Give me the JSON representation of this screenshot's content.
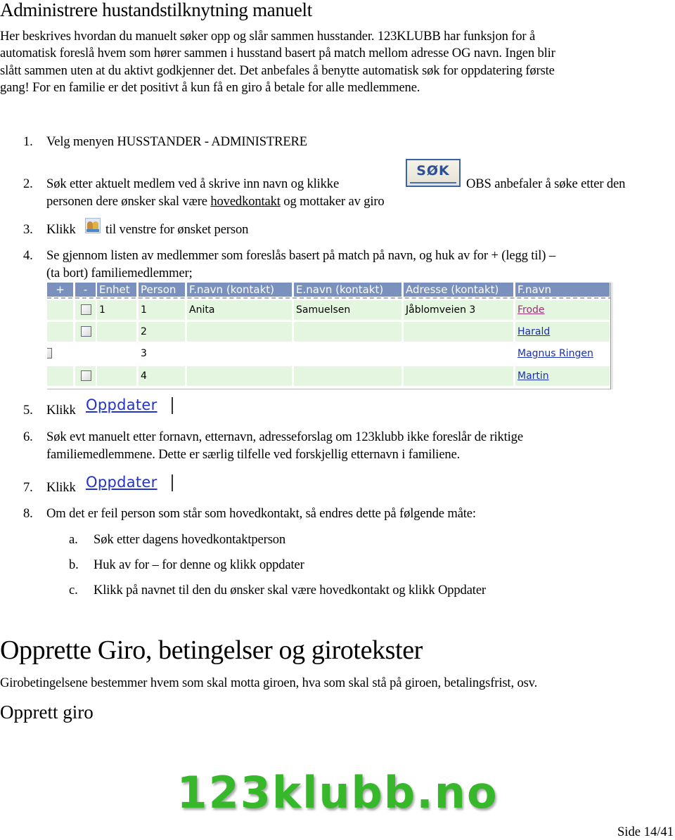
{
  "section1": {
    "title": "Administrere hustandstilknytning manuelt",
    "intro_lines": [
      "Her beskrives hvordan du manuelt søker opp og slår sammen husstander. 123KLUBB har funksjon for å",
      "automatisk foreslå hvem som hører sammen i husstand basert på match mellom adresse OG navn. Ingen blir",
      "slått sammen uten at du aktivt godkjenner det. Det anbefales å benytte automatisk søk for oppdatering første",
      "gang! For en familie er det positivt å kun få en giro å betale for alle medlemmene."
    ]
  },
  "steps": {
    "s1": {
      "num": "1.",
      "text": "Velg menyen HUSSTANDER - ADMINISTRERE"
    },
    "s2": {
      "num": "2.",
      "text_before": "Søk etter aktuelt medlem ved å skrive inn navn og klikke",
      "button_label": "SØK",
      "text_after": "OBS anbefaler å søke etter den",
      "line2_before": "personen dere ønsker skal være ",
      "line2_underlined": "hovedkontakt",
      "line2_after": " og mottaker av giro"
    },
    "s3": {
      "num": "3.",
      "text_before": "Klikk",
      "icon": "household-icon",
      "text_after": "til venstre for ønsket person"
    },
    "s4": {
      "num": "4.",
      "line1": "Se gjennom listen av medlemmer som foreslås basert på match på navn, og huk av for + (legg til) –",
      "line2": "(ta bort) familiemedlemmer;"
    },
    "s5": {
      "num": "5.",
      "text": "Klikk",
      "button_label": "Oppdater"
    },
    "s6": {
      "num": "6.",
      "line1": "Søk evt manuelt etter fornavn, etternavn, adresseforslag om 123klubb ikke foreslår de riktige",
      "line2": "familiemedlemmene. Dette er særlig tilfelle ved forskjellig etternavn i familiene."
    },
    "s7": {
      "num": "7.",
      "text": "Klikk",
      "button_label": "Oppdater"
    },
    "s8": {
      "num": "8.",
      "text": "Om det er feil person som står som hovedkontakt, så endres dette på følgende måte:",
      "sub": [
        {
          "num": "a.",
          "text": "Søk etter dagens hovedkontaktperson"
        },
        {
          "num": "b.",
          "text": "Huk av for – for denne og klikk oppdater"
        },
        {
          "num": "c.",
          "text": "Klikk på navnet til den du ønsker skal være hovedkontakt og klikk Oppdater"
        }
      ]
    }
  },
  "member_table": {
    "headers": [
      "+",
      "-",
      "Enhet",
      "Person",
      "F.navn (kontakt)",
      "E.navn (kontakt)",
      "Adresse (kontakt)",
      "F.navn"
    ],
    "header_color": "#7a90bd",
    "row_color": "#e4f6df",
    "rows": [
      {
        "plus_checkbox": false,
        "minus_checkbox": true,
        "enhet": "1",
        "person": "1",
        "fnavn_kontakt": "Anita",
        "enavn_kontakt": "Samuelsen",
        "adresse_kontakt": "Jåblomveien 3",
        "fnavn": "Frode",
        "checked": false,
        "highlight": true
      },
      {
        "plus_checkbox": false,
        "minus_checkbox": true,
        "enhet": "",
        "person": "2",
        "fnavn_kontakt": "",
        "enavn_kontakt": "",
        "adresse_kontakt": "",
        "fnavn": "Harald",
        "checked": false,
        "highlight": true
      },
      {
        "plus_checkbox": true,
        "minus_checkbox": false,
        "enhet": "",
        "person": "3",
        "fnavn_kontakt": "",
        "enavn_kontakt": "",
        "adresse_kontakt": "",
        "fnavn": "Magnus Ringen",
        "checked": false,
        "highlight": false
      },
      {
        "plus_checkbox": false,
        "minus_checkbox": true,
        "enhet": "",
        "person": "4",
        "fnavn_kontakt": "",
        "enavn_kontakt": "",
        "adresse_kontakt": "",
        "fnavn": "Martin",
        "checked": false,
        "highlight": true
      }
    ]
  },
  "section2": {
    "title": "Opprette Giro, betingelser og girotekster",
    "intro": "Girobetingelsene bestemmer hvem som skal motta giroen, hva som skal stå på giroen, betalingsfrist, osv.",
    "subtitle": "Opprett giro"
  },
  "logo": {
    "text": "123klubb.no",
    "color": "#36b82a"
  },
  "footer": {
    "page": "Side 14/41"
  }
}
